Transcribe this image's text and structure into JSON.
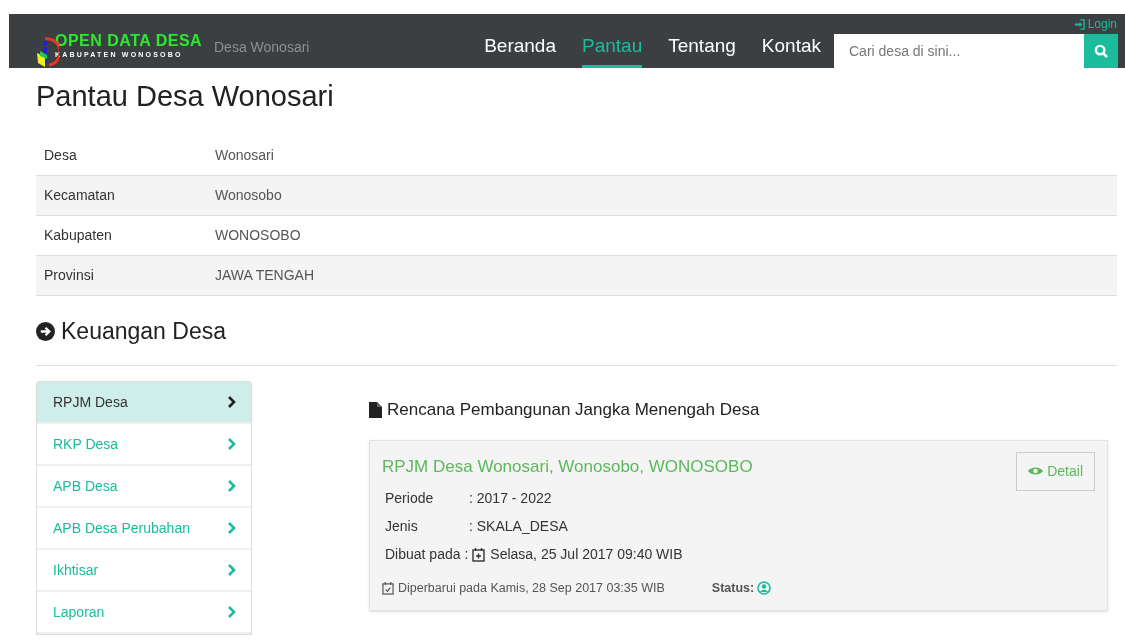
{
  "navbar": {
    "logo_title": "OPEN DATA DESA",
    "logo_subtitle": "KABUPATEN WONOSOBO",
    "breadcrumb": "Desa Wonosari",
    "login": "Login",
    "menu": [
      {
        "label": "Beranda",
        "selected": false
      },
      {
        "label": "Pantau",
        "selected": true
      },
      {
        "label": "Tentang",
        "selected": false
      },
      {
        "label": "Kontak",
        "selected": false
      }
    ],
    "search": {
      "placeholder": "Cari desa di sini..."
    }
  },
  "title": "Pantau Desa Wonosari",
  "info": [
    {
      "label": "Desa",
      "value": "Wonosari"
    },
    {
      "label": "Kecamatan",
      "value": "Wonosobo"
    },
    {
      "label": "Kabupaten",
      "value": "WONOSOBO"
    },
    {
      "label": "Provinsi",
      "value": "JAWA TENGAH"
    }
  ],
  "section_title": "Keuangan Desa",
  "sidebar": [
    {
      "label": "RPJM Desa",
      "selected": true
    },
    {
      "label": "RKP Desa",
      "selected": false
    },
    {
      "label": "APB Desa",
      "selected": false
    },
    {
      "label": "APB Desa Perubahan",
      "selected": false
    },
    {
      "label": "Ikhtisar",
      "selected": false
    },
    {
      "label": "Laporan",
      "selected": false
    }
  ],
  "panel": {
    "heading": "Rencana Pembangunan Jangka Menengah Desa",
    "card": {
      "title": "RPJM Desa Wonosari, Wonosobo, WONOSOBO",
      "detail": "Detail",
      "fields": [
        {
          "label": "Periode",
          "value": ": 2017 - 2022",
          "kind": "plain"
        },
        {
          "label": "Jenis",
          "value": ": SKALA_DESA",
          "kind": "plain"
        },
        {
          "label": "Dibuat pada :",
          "value": "Selasa, 25 Jul 2017 09:40 WIB",
          "kind": "date"
        }
      ],
      "updated": "Diperbarui pada Kamis, 28 Sep 2017 03:35 WIB",
      "status_label": "Status:"
    }
  }
}
